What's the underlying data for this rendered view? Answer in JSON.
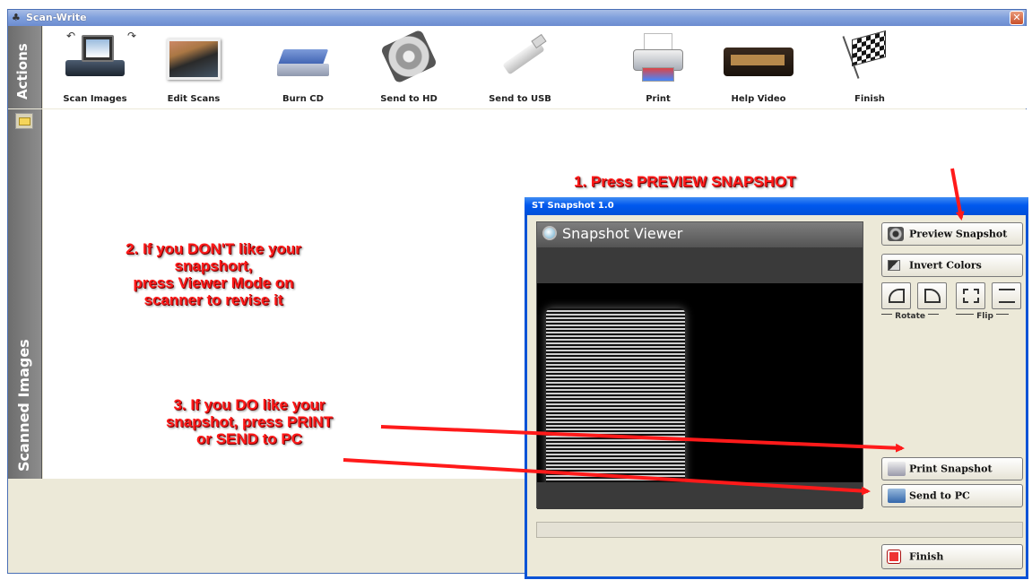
{
  "app": {
    "title": "Scan-Write",
    "close_glyph": "✕"
  },
  "actions": {
    "side_label": "Actions",
    "items": [
      {
        "label": "Scan Images",
        "icon": "scanner-icon"
      },
      {
        "label": "Edit Scans",
        "icon": "photo-icon"
      },
      {
        "label": "Burn CD",
        "icon": "cd-burner-icon"
      },
      {
        "label": "Send to HD",
        "icon": "hard-drive-icon"
      },
      {
        "label": "Send to USB",
        "icon": "usb-drive-icon"
      },
      {
        "label": "Print",
        "icon": "printer-icon"
      },
      {
        "label": "Help Video",
        "icon": "video-tape-icon"
      },
      {
        "label": "Finish",
        "icon": "checkered-flag-icon"
      }
    ]
  },
  "scanned": {
    "side_label": "Scanned Images"
  },
  "snapshot": {
    "title": "ST Snapshot 1.0",
    "viewer_title": "Snapshot Viewer",
    "buttons": {
      "preview": "Preview Snapshot",
      "invert": "Invert Colors",
      "rotate_label": "Rotate",
      "flip_label": "Flip",
      "print": "Print Snapshot",
      "send": "Send to PC",
      "finish": "Finish"
    }
  },
  "annotations": {
    "step1": "1. Press PREVIEW SNAPSHOT",
    "step2_lines": [
      "2. If you DON'T like your",
      "snapshort,",
      "press Viewer Mode on",
      "scanner to revise it"
    ],
    "step3_lines": [
      "3. If you DO like your",
      "snapshot, press PRINT",
      "or SEND to PC"
    ],
    "color": "#ff1a1a"
  }
}
